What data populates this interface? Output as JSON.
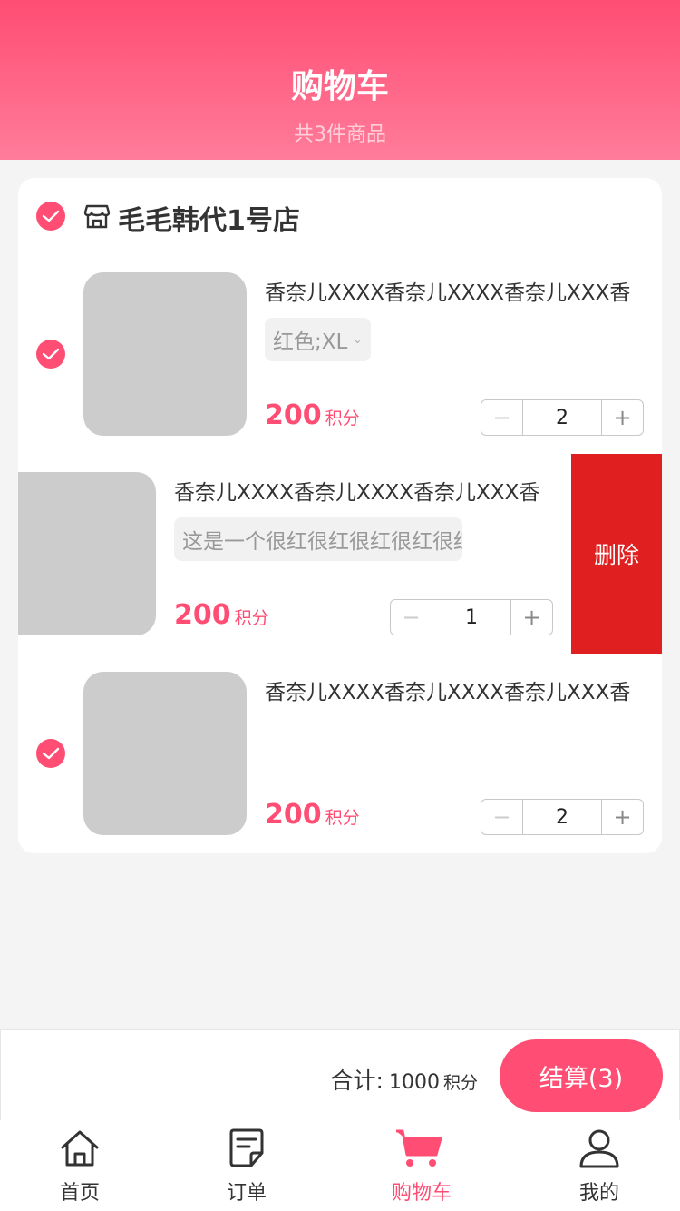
{
  "header": {
    "title": "购物车",
    "subtitle": "共3件商品"
  },
  "store": {
    "name": "毛毛韩代1号店",
    "checked": true
  },
  "items": [
    {
      "title": "香奈儿XXXX香奈儿XXXX香奈儿XXX香",
      "spec": "红色;XL",
      "price": "200",
      "price_unit": "积分",
      "qty": "2",
      "checked": true
    },
    {
      "title": "香奈儿XXXX香奈儿XXXX香奈儿XXX香",
      "spec": "这是一个很红很红很红很红很红的红",
      "price": "200",
      "price_unit": "积分",
      "qty": "1",
      "delete_label": "删除"
    },
    {
      "title": "香奈儿XXXX香奈儿XXXX香奈儿XXX香",
      "spec": "",
      "price": "200",
      "price_unit": "积分",
      "qty": "2",
      "checked": true
    }
  ],
  "stepper": {
    "minus": "−",
    "plus": "+"
  },
  "footer": {
    "total_label": "合计:",
    "total_value": "1000",
    "total_unit": "积分",
    "checkout_label": "结算(3)"
  },
  "tabbar": {
    "items": [
      {
        "label": "首页",
        "icon": "home-icon"
      },
      {
        "label": "订单",
        "icon": "order-icon"
      },
      {
        "label": "购物车",
        "icon": "cart-icon",
        "active": true
      },
      {
        "label": "我的",
        "icon": "user-icon"
      }
    ]
  },
  "colors": {
    "accent": "#ff4d73",
    "delete": "#e02020",
    "thumb_placeholder": "#cccccc"
  }
}
